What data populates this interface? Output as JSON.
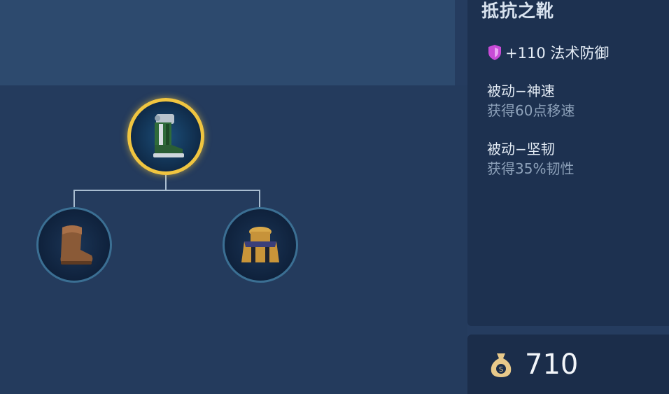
{
  "item": {
    "name": "抵抗之靴",
    "stat": "+110 法术防御",
    "passives": [
      {
        "title": "被动−神速",
        "desc": "获得60点移速"
      },
      {
        "title": "被动−坚韧",
        "desc": "获得35%韧性"
      }
    ],
    "price": "710"
  },
  "tree": {
    "root": "boots-of-resistance-icon",
    "children": [
      "basic-boots-icon",
      "golden-cape-icon"
    ]
  },
  "colors": {
    "gold_ring": "#f0c540",
    "stat_icon": "#c84bd6"
  }
}
